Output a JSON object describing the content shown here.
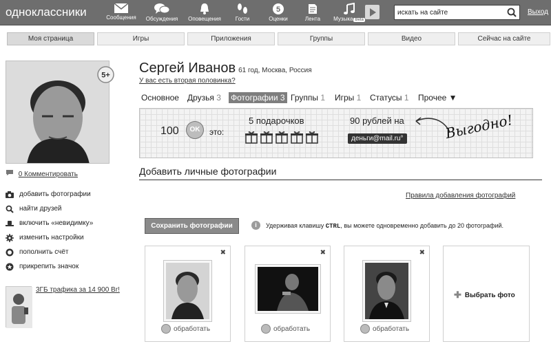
{
  "header": {
    "logo": "одноклассники",
    "nav": [
      {
        "label": "Сообщения",
        "icon": "envelope-icon"
      },
      {
        "label": "Обсуждения",
        "icon": "speech-bubbles-icon"
      },
      {
        "label": "Оповещения",
        "icon": "bell-icon"
      },
      {
        "label": "Гости",
        "icon": "footprints-icon"
      },
      {
        "label": "Оценки",
        "icon": "rating-five-icon",
        "value": "5"
      },
      {
        "label": "Лента",
        "icon": "feed-icon"
      },
      {
        "label": "Музыка",
        "icon": "music-note-icon",
        "badge": "Beta"
      }
    ],
    "search_placeholder": "искать на сайте",
    "logout": "Выход"
  },
  "tabs": [
    {
      "label": "Моя страница",
      "active": true
    },
    {
      "label": "Игры"
    },
    {
      "label": "Приложения"
    },
    {
      "label": "Группы"
    },
    {
      "label": "Видео"
    },
    {
      "label": "Сейчас на сайте"
    }
  ],
  "profile": {
    "name": "Сергей Иванов",
    "info": "61 год, Москва, Россия",
    "partner_link": "У вас есть вторая половинка?",
    "rating_badge": "5+"
  },
  "left": {
    "comments": "0 Комментировать",
    "menu": [
      {
        "label": "добавить фотографии",
        "icon": "camera-icon"
      },
      {
        "label": "найти друзей",
        "icon": "search-icon"
      },
      {
        "label": "включить «невидимку»",
        "icon": "hat-icon"
      },
      {
        "label": "изменить настройки",
        "icon": "gear-icon"
      },
      {
        "label": "пополнить счёт",
        "icon": "coin-icon"
      },
      {
        "label": "прикрепить значок",
        "icon": "star-badge-icon"
      }
    ],
    "promo": "3ГБ трафика за 14 900 Br!"
  },
  "subnav": [
    {
      "label": "Основное",
      "count": ""
    },
    {
      "label": "Друзья",
      "count": "3"
    },
    {
      "label": "Фотографии",
      "count": "3",
      "active": true
    },
    {
      "label": "Группы",
      "count": "1"
    },
    {
      "label": "Игры",
      "count": "1"
    },
    {
      "label": "Статусы",
      "count": "1"
    },
    {
      "label": "Прочее ▼",
      "count": ""
    }
  ],
  "banner": {
    "amount": "100",
    "ok_label": "OK",
    "eto": "это:",
    "gifts": "5 подарочков",
    "rubles": "90 рублей на",
    "service": "деньги@mail.ru°",
    "slogan": "Выгодно!"
  },
  "photos": {
    "section_title": "Добавить личные фотографии",
    "rules_link": "Правила добавления фотографий",
    "save_button": "Сохранить фотографии",
    "hint_prefix": "Удерживая клавишу",
    "hint_key": "CTRL",
    "hint_suffix": ", вы можете одновременно добавить до 20 фотографий.",
    "items": [
      {
        "edit": "обработать"
      },
      {
        "edit": "обработать"
      },
      {
        "edit": "обработать"
      }
    ],
    "pick_label": "Выбрать фото"
  },
  "colors": {
    "topbar": "#6e6e6e",
    "tab_bg": "#efefef",
    "active_subnav": "#7e7e7e",
    "button": "#8a8a8a"
  }
}
